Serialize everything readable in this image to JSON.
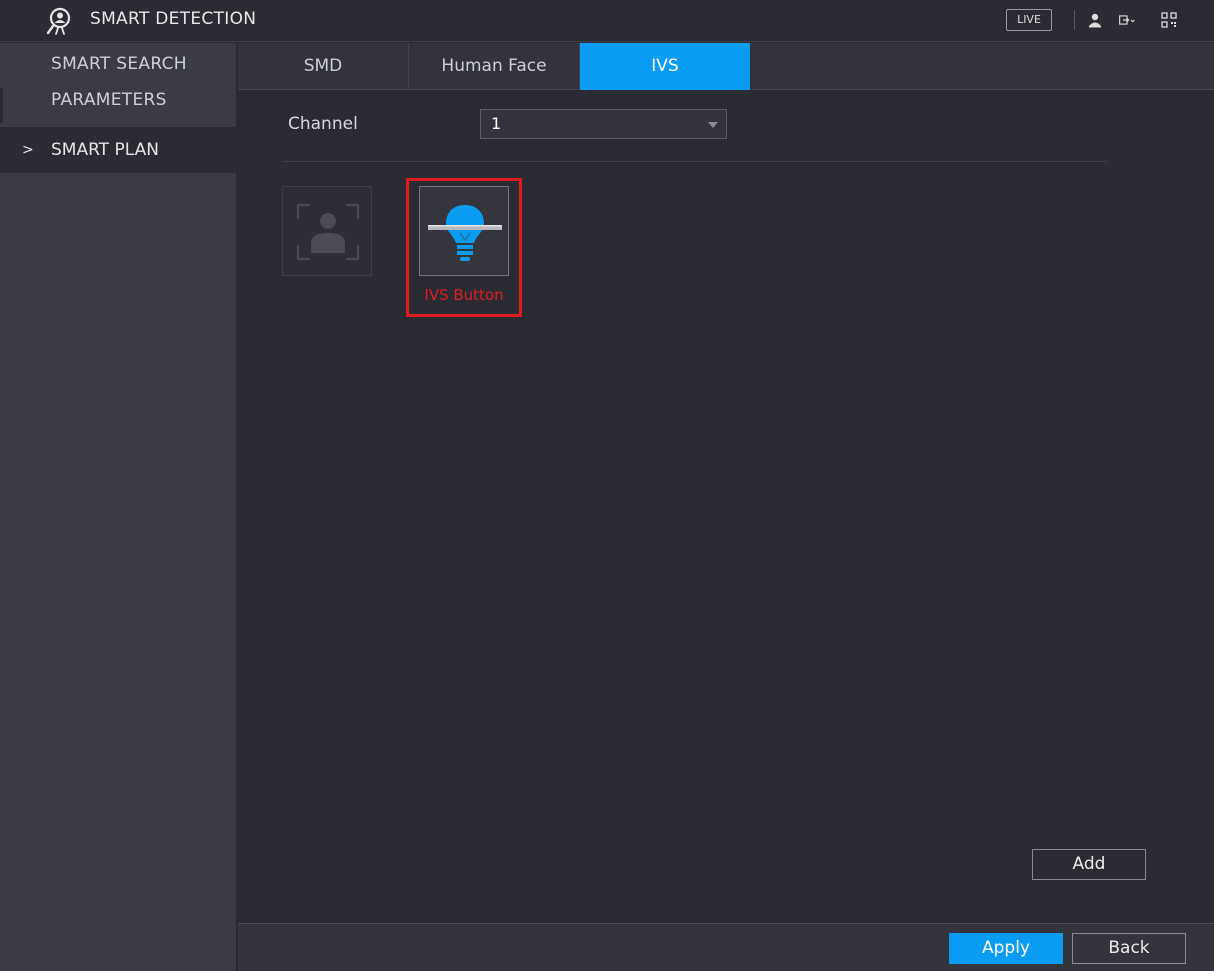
{
  "window": {
    "title": "SMART DETECTION",
    "live_label": "LIVE"
  },
  "sidebar": {
    "items": [
      {
        "label": "SMART SEARCH"
      },
      {
        "label": "PARAMETERS"
      },
      {
        "label": "SMART PLAN",
        "selected": true
      }
    ],
    "chevron": ">"
  },
  "tabs": [
    {
      "label": "SMD",
      "active": false
    },
    {
      "label": "Human Face",
      "active": false
    },
    {
      "label": "IVS",
      "active": true
    }
  ],
  "channel": {
    "label": "Channel",
    "value": "1"
  },
  "plans": {
    "face_icon": "face-detection-icon",
    "ivs_icon": "ivs-lightbulb-icon",
    "annotation_label": "IVS Button"
  },
  "buttons": {
    "add": "Add",
    "apply": "Apply",
    "back": "Back"
  },
  "colors": {
    "accent": "#0a9cf2",
    "highlight": "#e31b23",
    "background": "#2a2b33",
    "sidebar": "#3a3b44"
  }
}
